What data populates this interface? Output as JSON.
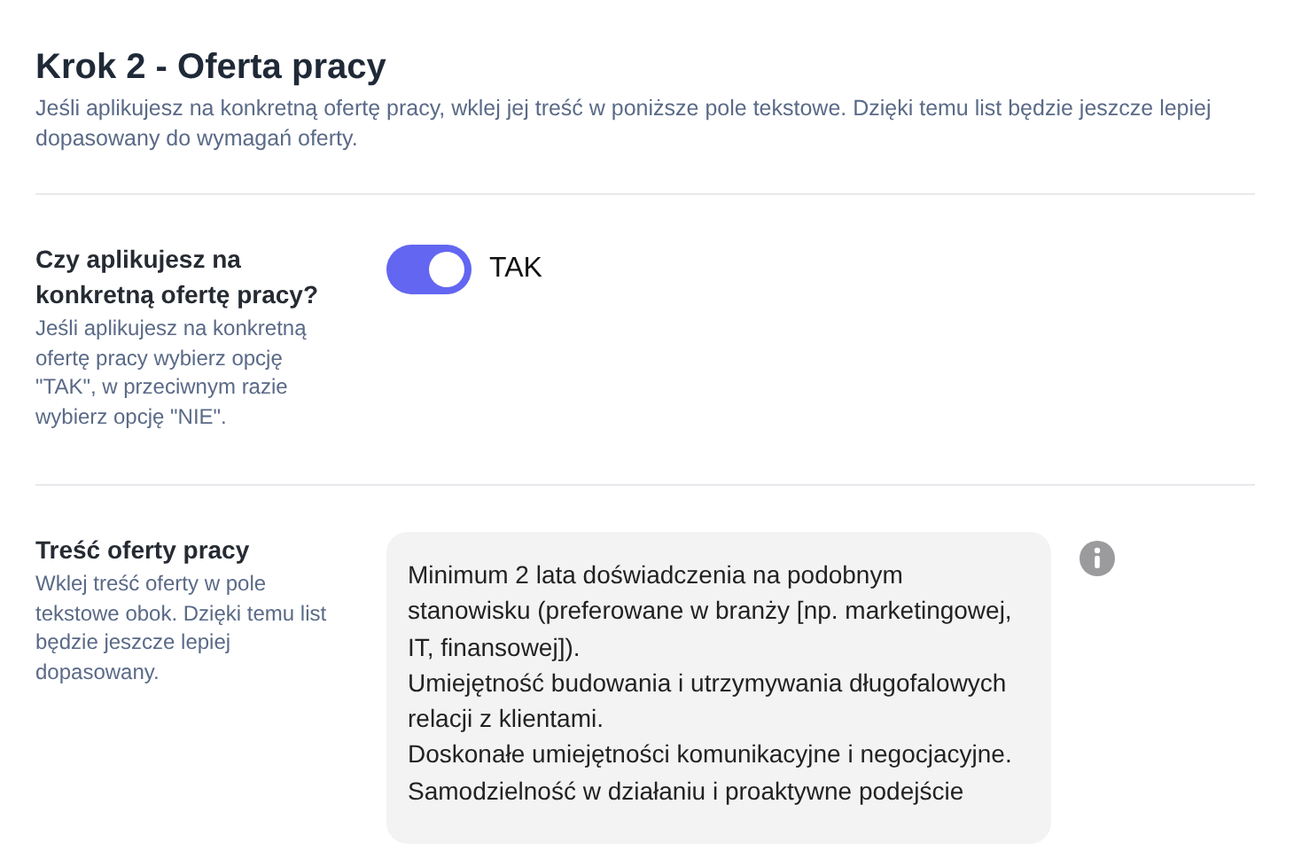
{
  "header": {
    "title": "Krok 2 - Oferta pracy",
    "description": "Jeśli aplikujesz na konkretną ofertę pracy, wklej jej treść w poniższe pole tekstowe. Dzięki temu list będzie jeszcze lepiej dopasowany do wymagań oferty."
  },
  "fields": [
    {
      "kind": "toggle",
      "label": "Czy aplikujesz na konkretną ofertę pracy?",
      "help": "Jeśli aplikujesz na konkretną ofertę pracy wybierz opcję \"TAK\", w przeciwnym razie wybierz opcję \"NIE\".",
      "on": true,
      "value_label": "TAK"
    },
    {
      "kind": "textarea",
      "label": "Treść oferty pracy",
      "help": "Wklej treść oferty w pole tekstowe obok. Dzięki temu list będzie jeszcze lepiej dopasowany.",
      "value": "Minimum 2 lata doświadczenia na podobnym stanowisku (preferowane w branży [np. marketingowej, IT, finansowej]).\nUmiejętność budowania i utrzymywania długofalowych relacji z klientami.\nDoskonałe umiejętności komunikacyjne i negocjacyjne.\nSamodzielność w działaniu i proaktywne podejście"
    }
  ]
}
